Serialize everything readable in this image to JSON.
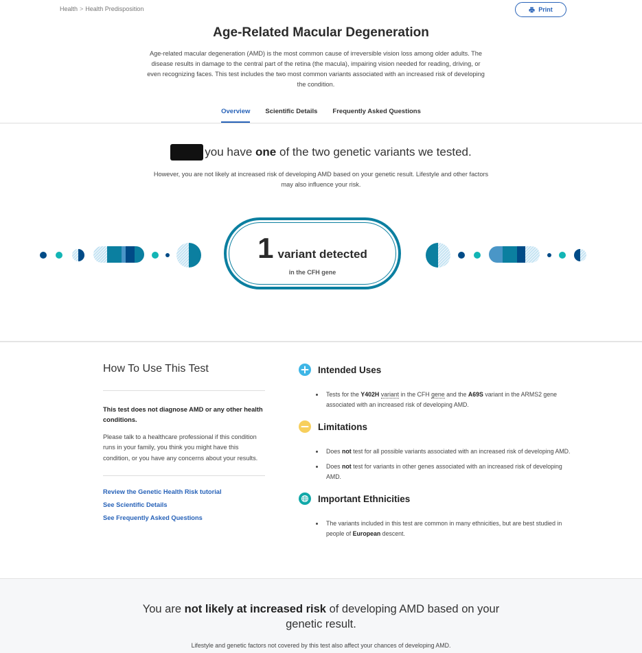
{
  "breadcrumb": {
    "items": [
      "Health",
      "Health Predisposition"
    ],
    "separator": ">"
  },
  "toolbar": {
    "print_label": "Print",
    "print_icon": "printer-icon"
  },
  "page": {
    "title": "Age-Related Macular Degeneration",
    "intro": "Age-related macular degeneration (AMD) is the most common cause of irreversible vision loss among older adults. The disease results in damage to the central part of the retina (the macula), impairing vision needed for reading, driving, or even recognizing faces. This test includes the two most common variants associated with an increased risk of developing the condition."
  },
  "tabs": [
    {
      "label": "Overview",
      "active": true
    },
    {
      "label": "Scientific Details",
      "active": false
    },
    {
      "label": "Frequently Asked Questions",
      "active": false
    }
  ],
  "result": {
    "headline_pre": "you have ",
    "headline_bold": "one",
    "headline_post": " of the two genetic variants we tested.",
    "subtext": "However, you are not likely at increased risk of developing AMD based on your genetic result. Lifestyle and other factors may also influence your risk.",
    "variant_count": "1",
    "variant_label": "variant detected",
    "variant_gene": "in the CFH gene"
  },
  "colors": {
    "accent_blue": "#2762b8",
    "teal": "#0b7fa0",
    "navy": "#004b87",
    "aqua": "#12b5b5",
    "light_blue": "#4a96c7",
    "plus_icon": "#3fb6e6",
    "minus_icon": "#f7cf5c",
    "globe_icon": "#10a8a8"
  },
  "howto": {
    "title": "How To Use This Test",
    "bold_text": "This test does not diagnose AMD or any other health conditions.",
    "text": "Please talk to a healthcare professional if this condition runs in your family, you think you might have this condition, or you have any concerns about your results.",
    "links": [
      "Review the Genetic Health Risk tutorial",
      "See Scientific Details",
      "See Frequently Asked Questions"
    ]
  },
  "info": {
    "intended_uses": {
      "title": "Intended Uses",
      "icon": "plus-circle-icon",
      "items": [
        {
          "p1": "Tests for the ",
          "b1": "Y402H",
          "p2": " ",
          "d1": "variant",
          "p3": " in the CFH ",
          "d2": "gene",
          "p4": " and the ",
          "b2": "A69S",
          "p5": " variant in the ARMS2 gene associated with an increased risk of developing AMD."
        }
      ]
    },
    "limitations": {
      "title": "Limitations",
      "icon": "minus-circle-icon",
      "items": [
        {
          "pre": "Does ",
          "bold": "not",
          "post": " test for all possible variants associated with an increased risk of developing AMD."
        },
        {
          "pre": "Does ",
          "bold": "not",
          "post": " test for variants in other genes associated with an increased risk of developing AMD."
        }
      ]
    },
    "ethnicities": {
      "title": "Important Ethnicities",
      "icon": "globe-icon",
      "items": [
        {
          "pre": "The variants included in this test are common in many ethnicities, but are best studied in people of ",
          "bold": "European",
          "post": " descent."
        }
      ]
    }
  },
  "bottom": {
    "pre": "You are ",
    "bold": "not likely at increased risk",
    "post": " of developing AMD based on your genetic result.",
    "subtext": "Lifestyle and genetic factors not covered by this test also affect your chances of developing AMD."
  }
}
